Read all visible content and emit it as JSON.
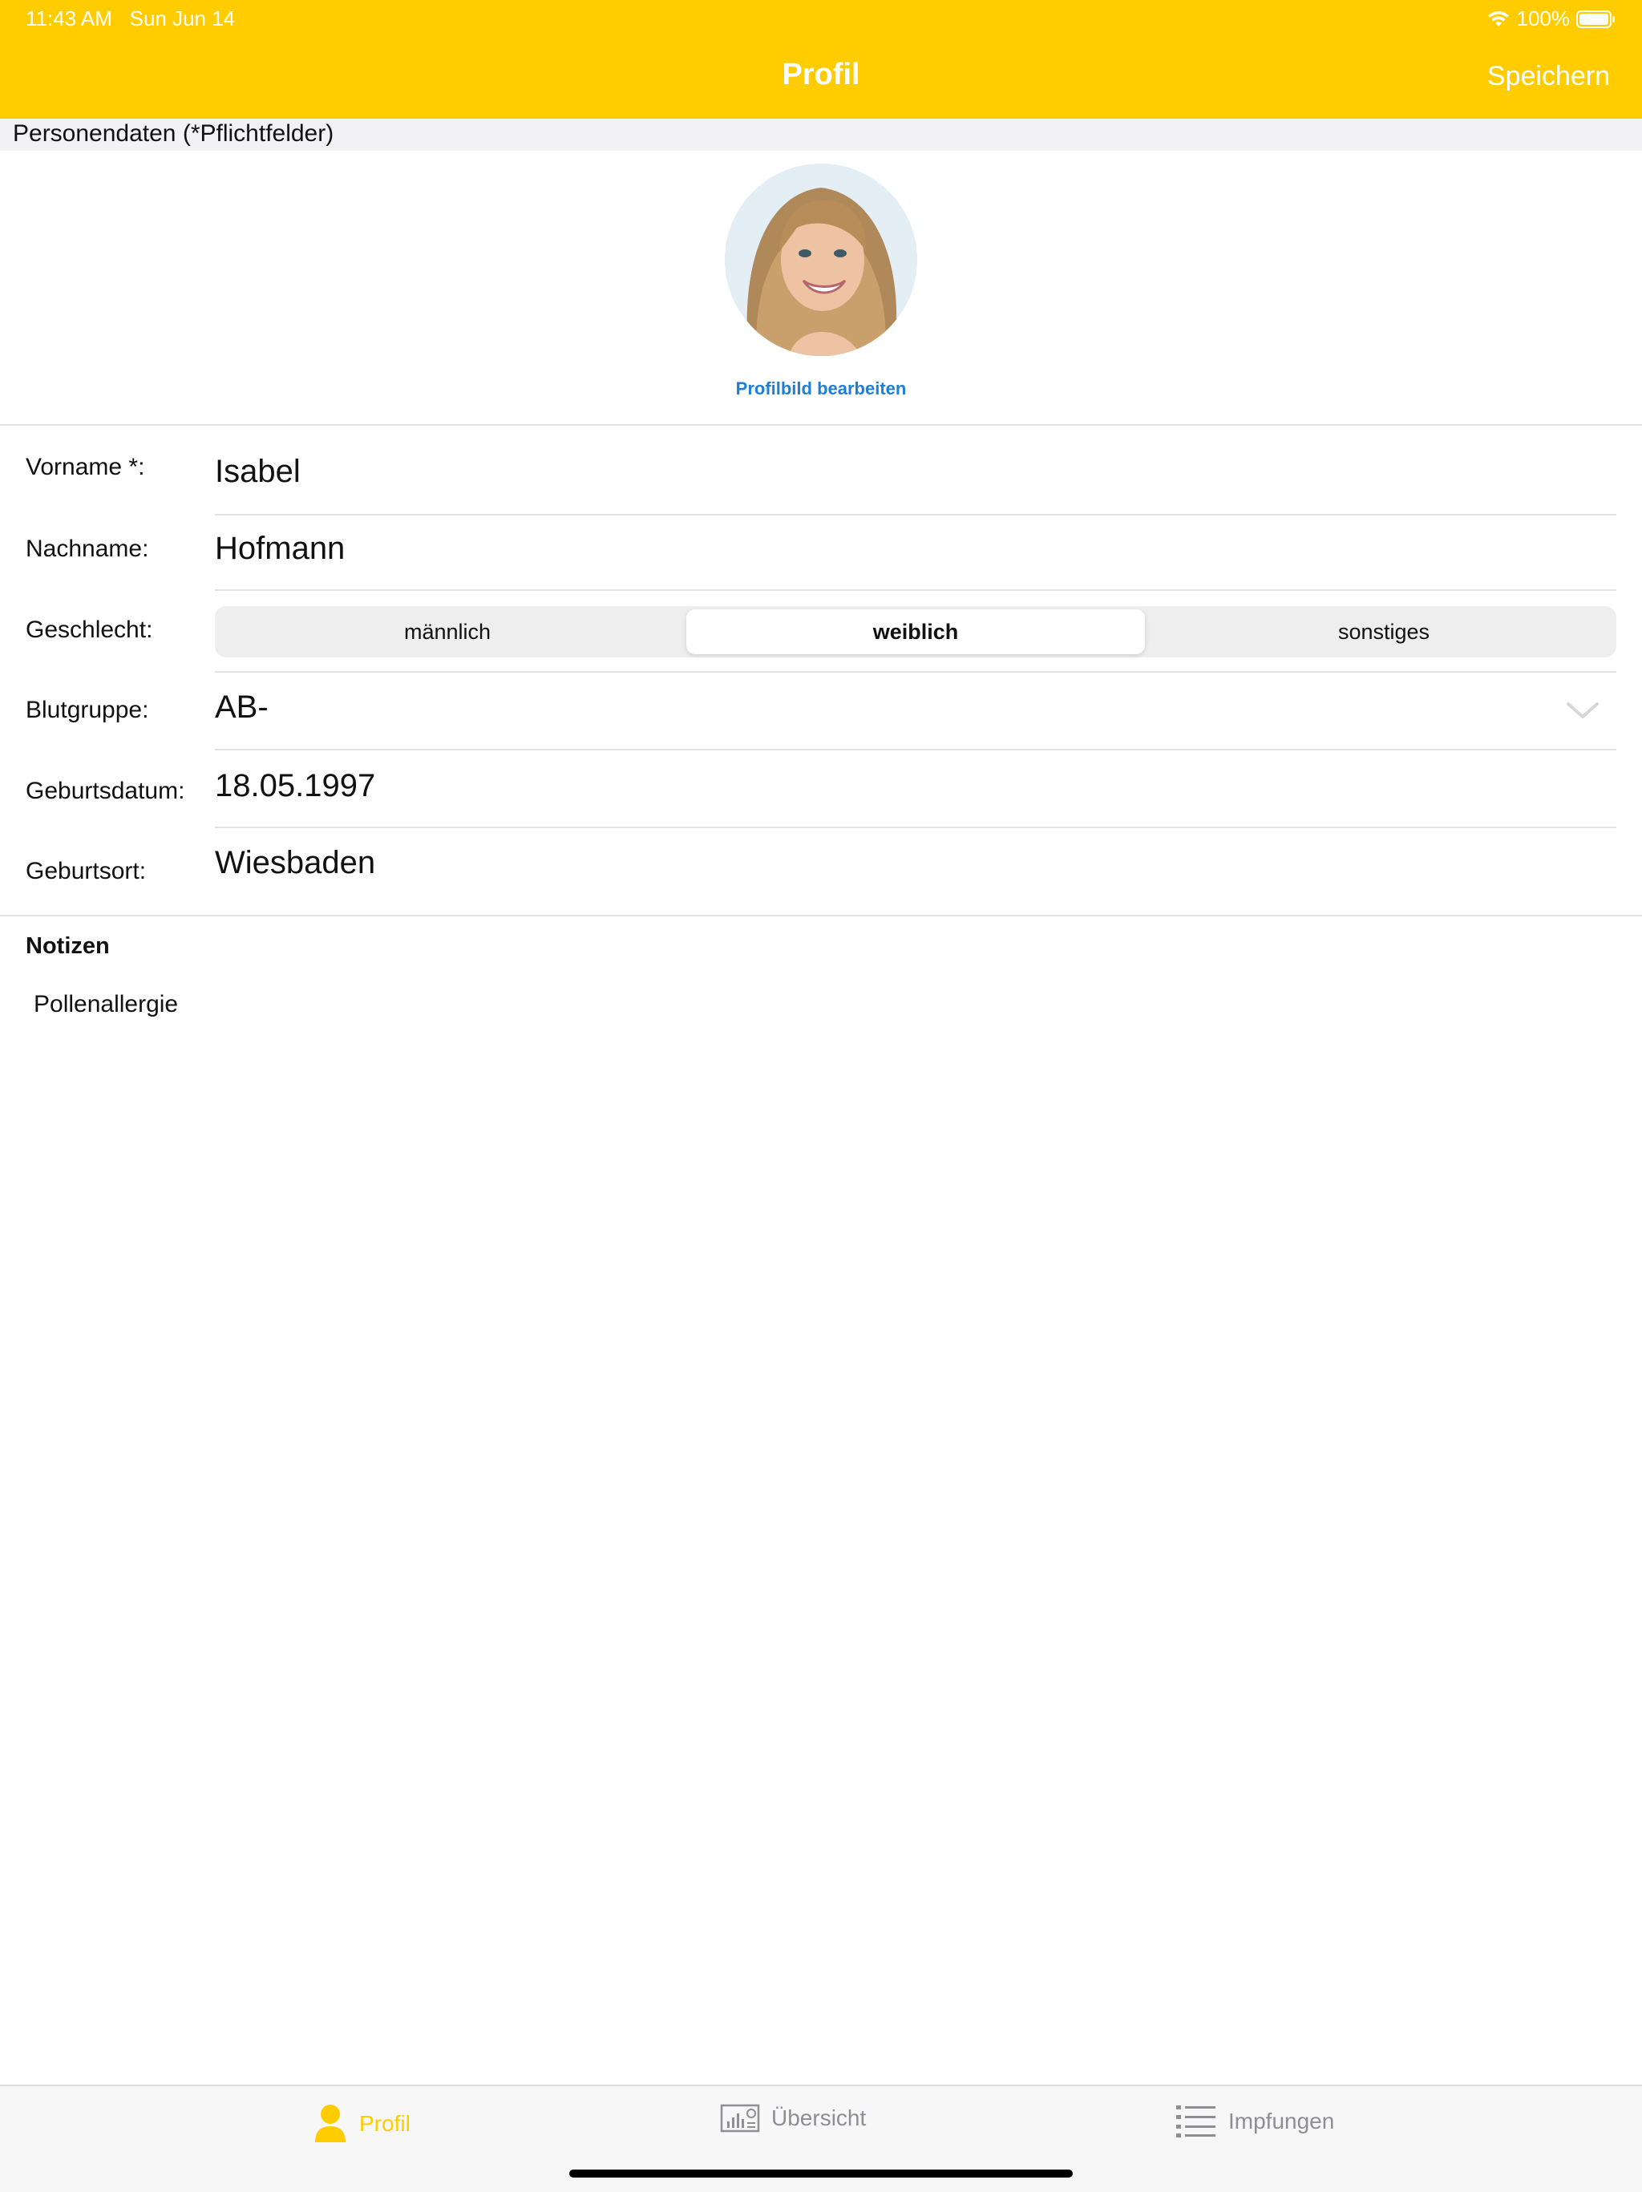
{
  "status_bar": {
    "time": "11:43 AM",
    "date": "Sun Jun 14",
    "battery": "100%",
    "icons": [
      "wifi-icon",
      "battery-icon"
    ]
  },
  "nav": {
    "title": "Profil",
    "save_label": "Speichern"
  },
  "colors": {
    "accent": "#FFCC00",
    "link": "#1E7FD6",
    "tab_inactive": "#8E8E93"
  },
  "section": {
    "header": "Personendaten (*Pflichtfelder)"
  },
  "avatar": {
    "edit_label": "Profilbild bearbeiten"
  },
  "form": {
    "first_name": {
      "label": "Vorname *:",
      "value": "Isabel"
    },
    "last_name": {
      "label": "Nachname:",
      "value": "Hofmann"
    },
    "gender": {
      "label": "Geschlecht:",
      "options": [
        "männlich",
        "weiblich",
        "sonstiges"
      ],
      "selected": "weiblich"
    },
    "blood_type": {
      "label": "Blutgruppe:",
      "value": "AB-"
    },
    "birth_date": {
      "label": "Geburtsdatum:",
      "value": "18.05.1997"
    },
    "birth_place": {
      "label": "Geburtsort:",
      "value": "Wiesbaden"
    }
  },
  "notes": {
    "title": "Notizen",
    "text": "Pollenallergie"
  },
  "tabs": [
    {
      "label": "Profil",
      "icon": "person-icon",
      "active": true
    },
    {
      "label": "Übersicht",
      "icon": "overview-icon",
      "active": false
    },
    {
      "label": "Impfungen",
      "icon": "list-icon",
      "active": false
    }
  ]
}
